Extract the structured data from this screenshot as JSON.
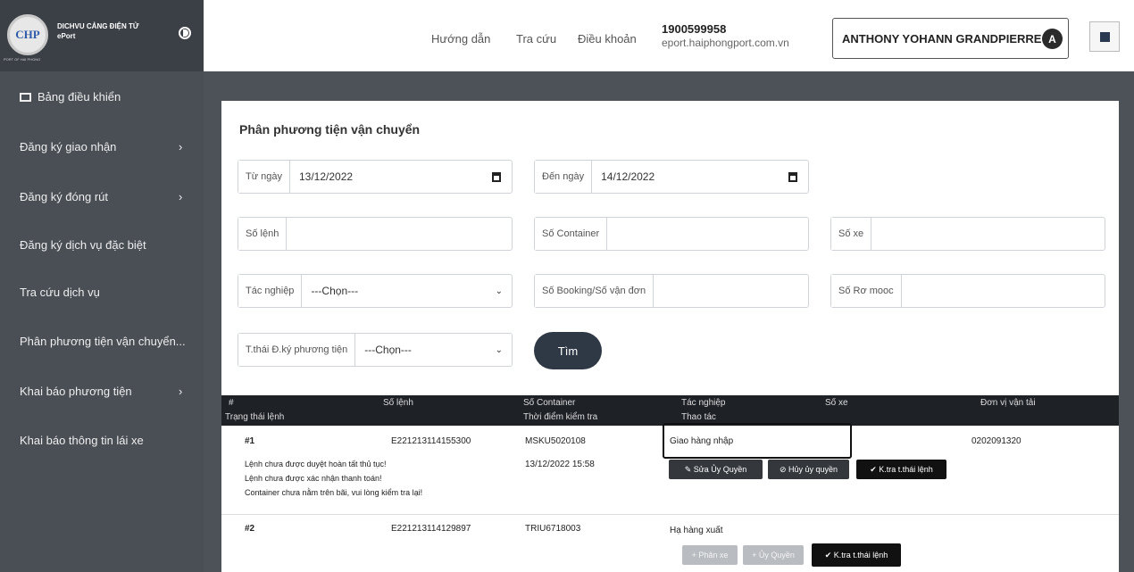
{
  "header": {
    "logo_text": "CHP",
    "brand_line1": "DICHVU CẢNG ĐIỆN TỬ",
    "brand_line2": "ePort",
    "brand_sub": "PORT OF HAI PHONG",
    "nav": [
      "Hướng dẫn",
      "Tra cứu",
      "Điều khoản"
    ],
    "phone": "1900599958",
    "site": "eport.haiphongport.com.vn",
    "user_name": "ANTHONY YOHANN GRANDPIERRE",
    "avatar_letter": "A"
  },
  "sidebar": {
    "items": [
      {
        "label": "Bảng điều khiển",
        "chevron": ""
      },
      {
        "label": "Đăng ký giao nhận",
        "chevron": "›"
      },
      {
        "label": "Đăng ký đóng rút",
        "chevron": "›"
      },
      {
        "label": "Đăng ký dịch vụ đặc biệt",
        "chevron": ""
      },
      {
        "label": "Tra cứu dịch vụ",
        "chevron": ""
      },
      {
        "label": "Phân phương tiện vận chuyển...",
        "chevron": ""
      },
      {
        "label": "Khai báo phương tiện",
        "chevron": "›"
      },
      {
        "label": "Khai báo thông tin lái xe",
        "chevron": ""
      }
    ]
  },
  "main": {
    "title": "Phân phương tiện vận chuyển",
    "filters": {
      "from_label": "Từ ngày",
      "from_value": "13/12/2022",
      "to_label": "Đến ngày",
      "to_value": "14/12/2022",
      "so_lenh_label": "Số lệnh",
      "so_lenh_value": "",
      "container_label": "Số Container",
      "container_value": "",
      "so_xe_label": "Số xe",
      "so_xe_value": "",
      "tac_nghiep_label": "Tác nghiệp",
      "tac_nghiep_value": "---Chọn---",
      "booking_label": "Số Booking/Số vận đơn",
      "booking_value": "",
      "ro_mooc_label": "Số Rơ mooc",
      "ro_mooc_value": "",
      "trang_thai_label": "T.thái Đ.ký phương tiện",
      "trang_thai_value": "---Chọn---",
      "search_button": "Tìm"
    },
    "table": {
      "headers": {
        "idx": "#",
        "status": "Trạng thái lệnh",
        "so_lenh": "Số lệnh",
        "container": "Số Container",
        "check_time": "Thời điểm kiểm tra",
        "tac_nghiep": "Tác nghiệp",
        "thao_tac": "Thao tác",
        "so_xe": "Số xe",
        "don_vi": "Đơn vị vận tải"
      },
      "rows": [
        {
          "idx": "#1",
          "so_lenh": "E221213114155300",
          "container": "MSKU5020108",
          "check_time": "13/12/2022 15:58",
          "tac_nghiep": "Giao hàng nhập",
          "don_vi": "0202091320",
          "messages": [
            "Lệnh chưa được duyệt hoàn tất thủ tục!",
            "Lệnh chưa được xác nhận thanh toán!",
            "Container chưa nằm trên bãi, vui lòng kiểm tra lại!"
          ],
          "actions": [
            "✎ Sửa Ủy Quyền",
            "⊘ Hủy ủy quyền",
            "✔ K.tra t.thái lệnh"
          ]
        },
        {
          "idx": "#2",
          "so_lenh": "E221213114129897",
          "container": "TRIU6718003",
          "tac_nghiep": "Hạ hàng xuất",
          "actions": [
            "+ Phân xe",
            "+ Ủy Quyền",
            "✔ K.tra t.thái lệnh"
          ]
        }
      ]
    }
  }
}
